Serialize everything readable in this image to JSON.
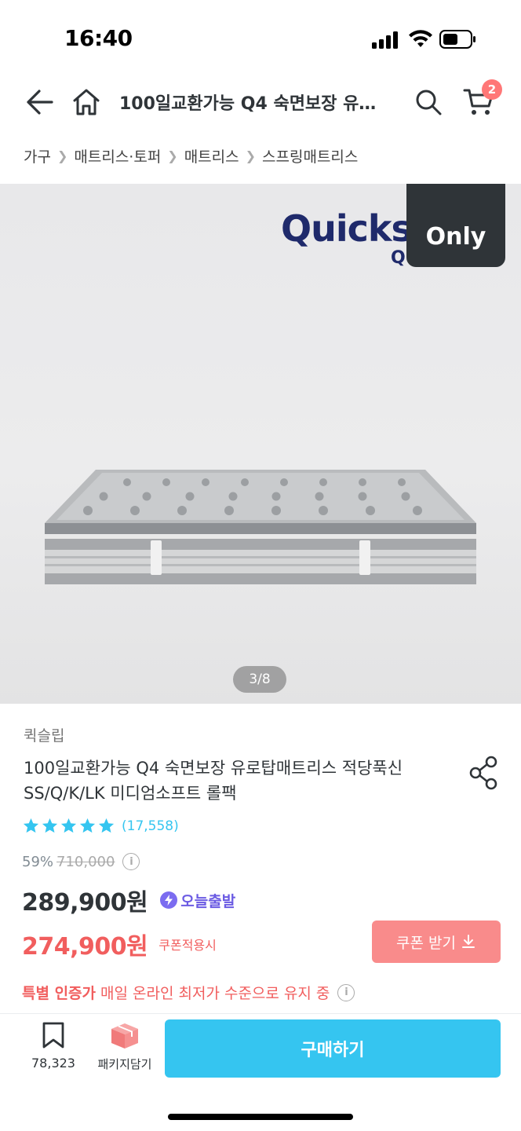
{
  "status_bar": {
    "time": "16:40"
  },
  "header": {
    "title": "100일교환가능 Q4 숙면보장 유…",
    "cart_count": "2"
  },
  "breadcrumb": [
    "가구",
    "매트리스·토퍼",
    "매트리스",
    "스프링매트리스"
  ],
  "gallery": {
    "logo_text": "Quicksl",
    "logo_sub": "QUICK 4",
    "only_badge": "Only",
    "page_indicator": "3/8"
  },
  "product": {
    "brand": "퀵슬립",
    "title": "100일교환가능 Q4 숙면보장 유로탑매트리스 적당푹신 SS/Q/K/LK 미디엄소프트 롤팩",
    "rating": 5,
    "review_count": "(17,558)",
    "discount_pct": "59%",
    "original_price": "710,000",
    "price": "289,900원",
    "delivery_badge": "오늘출발",
    "coupon_price": "274,900원",
    "coupon_note": "쿠폰적용시",
    "coupon_button": "쿠폰 받기",
    "special_strong": "특별 인증가",
    "special_rest": "매일 온라인 최저가 수준으로 유지 중"
  },
  "bottom_bar": {
    "bookmark_count": "78,323",
    "package_label": "패키지담기",
    "buy_label": "구매하기"
  },
  "colors": {
    "accent": "#35c5f0",
    "sale_red": "#f15e5e",
    "coupon_button": "#f98b8b",
    "delivery_purple": "#6b5be3",
    "text": "#2f3438"
  }
}
